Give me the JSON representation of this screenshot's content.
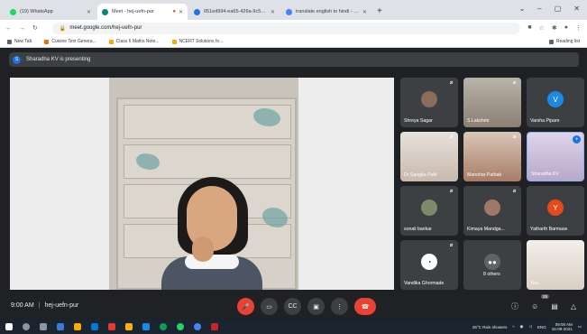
{
  "browser": {
    "tabs": [
      {
        "label": "(19) WhatsApp",
        "color": "#25d366",
        "active": false
      },
      {
        "label": "Meet - hej-uefn-pur",
        "color": "#00897b",
        "active": true
      },
      {
        "label": "051ed994-ea65-426a-9c5d-4c1...",
        "color": "#1a73e8",
        "active": false
      },
      {
        "label": "translate english to hindi - Goog...",
        "color": "#4285f4",
        "active": false
      }
    ],
    "new_tab": "+",
    "url": "meet.google.com/hej-uefn-pur",
    "bookmarks": [
      {
        "label": "New Tab"
      },
      {
        "label": "Cuisine Text Genera..."
      },
      {
        "label": "Class 6 Maths Note..."
      },
      {
        "label": "NCERT Solutions fo..."
      }
    ],
    "reading_list": "Reading list"
  },
  "meet": {
    "presenting_banner": "Sharadha KV is presenting",
    "presenter_initial": "S",
    "meeting_time": "9:00 AM",
    "meeting_code": "hej-uefn-pur",
    "participant_count": "29",
    "participants": [
      {
        "name": "Shreya Sagar",
        "kind": "photo",
        "muted": true
      },
      {
        "name": "S.Lakshmi",
        "kind": "camera",
        "muted": true
      },
      {
        "name": "Varsha Pipare",
        "kind": "letter",
        "letter": "V",
        "color": "#1e88e5",
        "muted": false
      },
      {
        "name": "Dr Sangita Patil",
        "kind": "camera",
        "muted": true
      },
      {
        "name": "Manohar Pathak",
        "kind": "camera",
        "muted": true
      },
      {
        "name": "Sharadha KV",
        "kind": "camera",
        "muted": false,
        "pinned": true
      },
      {
        "name": "sonali bankar",
        "kind": "photo",
        "muted": true
      },
      {
        "name": "Kimaya Mandga...",
        "kind": "photo",
        "muted": true
      },
      {
        "name": "Yatharth Barmase",
        "kind": "letter",
        "letter": "Y",
        "color": "#e64a19",
        "muted": false
      },
      {
        "name": "Vandika Ghormade",
        "kind": "photo",
        "muted": true
      },
      {
        "name": "8 others",
        "kind": "group",
        "muted": false
      },
      {
        "name": "You",
        "kind": "camera",
        "muted": true
      }
    ]
  },
  "taskbar": {
    "weather": "26°C  Rain showers",
    "lang": "ENG",
    "time": "09:00 AM",
    "date": "16-09-2021"
  }
}
